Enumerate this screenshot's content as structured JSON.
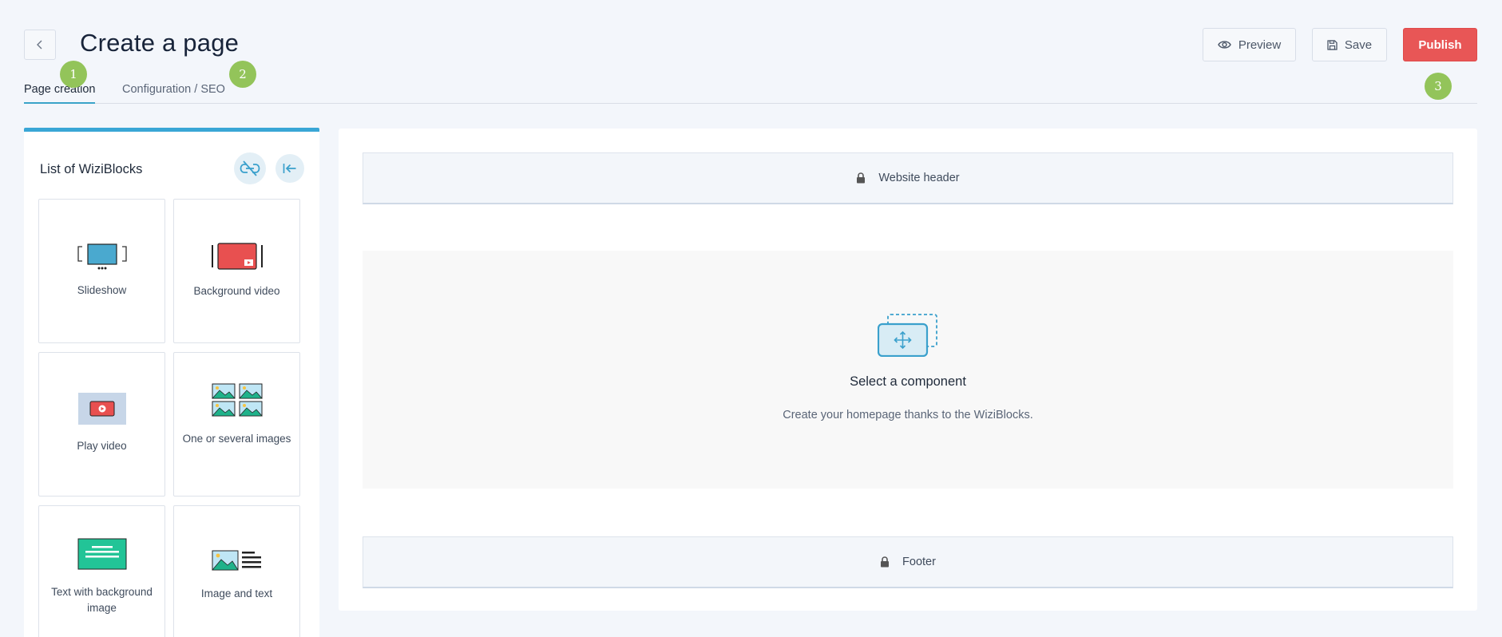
{
  "header": {
    "title": "Create a page",
    "preview_label": "Preview",
    "save_label": "Save",
    "publish_label": "Publish"
  },
  "tabs": [
    {
      "label": "Page creation"
    },
    {
      "label": "Configuration / SEO"
    }
  ],
  "steps": [
    "1",
    "2",
    "3"
  ],
  "panel": {
    "title": "List of WiziBlocks",
    "blocks": [
      {
        "label": "Slideshow"
      },
      {
        "label": "Background video"
      },
      {
        "label": "Play video"
      },
      {
        "label": "One or several images"
      },
      {
        "label": "Text with background image"
      },
      {
        "label": "Image and text"
      }
    ]
  },
  "canvas": {
    "header_label": "Website header",
    "footer_label": "Footer",
    "dropzone_title": "Select a component",
    "dropzone_subtitle": "Create your homepage thanks to the WiziBlocks."
  },
  "colors": {
    "accent": "#39a6d6",
    "publish": "#e85656",
    "badge": "#93c45a"
  }
}
